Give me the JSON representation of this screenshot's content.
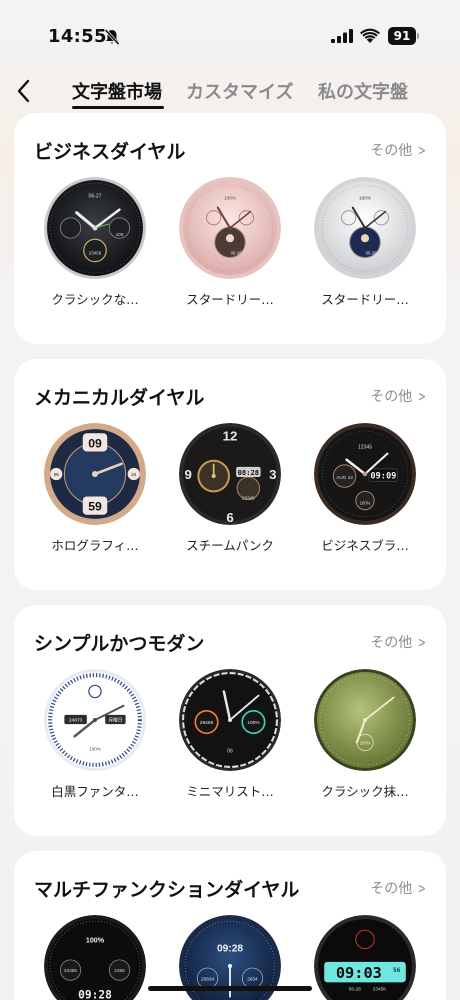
{
  "status": {
    "time": "14:55",
    "battery": "91"
  },
  "nav": {
    "tabs": [
      "文字盤市場",
      "カスタマイズ",
      "私の文字盤"
    ]
  },
  "sections": [
    {
      "title": "ビジネスダイヤル",
      "more": "その他",
      "items": [
        {
          "label": "クラシックな…",
          "dial_texts": [
            "06-27",
            "100",
            "23456"
          ]
        },
        {
          "label": "スタードリー…",
          "dial_texts": [
            "100%",
            "05-26"
          ]
        },
        {
          "label": "スタードリー…",
          "dial_texts": [
            "100%",
            "05-26"
          ]
        }
      ]
    },
    {
      "title": "メカニカルダイヤル",
      "more": "その他",
      "items": [
        {
          "label": "ホログラフィ…",
          "dial_texts": [
            "09",
            "59",
            "06",
            "24"
          ]
        },
        {
          "label": "スチームパンク",
          "dial_texts": [
            "12",
            "3",
            "6",
            "9",
            "08:28",
            "22345"
          ]
        },
        {
          "label": "ビジネスブラ…",
          "dial_texts": [
            "12345",
            "AUG 22",
            "09:09",
            "100%"
          ]
        }
      ]
    },
    {
      "title": "シンプルかつモダン",
      "more": "その他",
      "items": [
        {
          "label": "白黒ファンタ…",
          "dial_texts": [
            "24873",
            "月曜日",
            "100%"
          ]
        },
        {
          "label": "ミニマリスト…",
          "dial_texts": [
            "29456",
            "100%",
            "06"
          ]
        },
        {
          "label": "クラシック抹…",
          "dial_texts": [
            "100%"
          ]
        }
      ]
    },
    {
      "title": "マルチファンクションダイヤル",
      "more": "その他",
      "items": [
        {
          "label": "",
          "dial_texts": [
            "100%",
            "23455",
            "2355",
            "09:28"
          ]
        },
        {
          "label": "",
          "dial_texts": [
            "09:28",
            "25634",
            "2634"
          ]
        },
        {
          "label": "",
          "dial_texts": [
            "09:03",
            "56",
            "05-28",
            "23458"
          ]
        }
      ]
    }
  ],
  "colors": {
    "accent": "#111111",
    "muted": "#8e8e93",
    "card": "#ffffff"
  }
}
